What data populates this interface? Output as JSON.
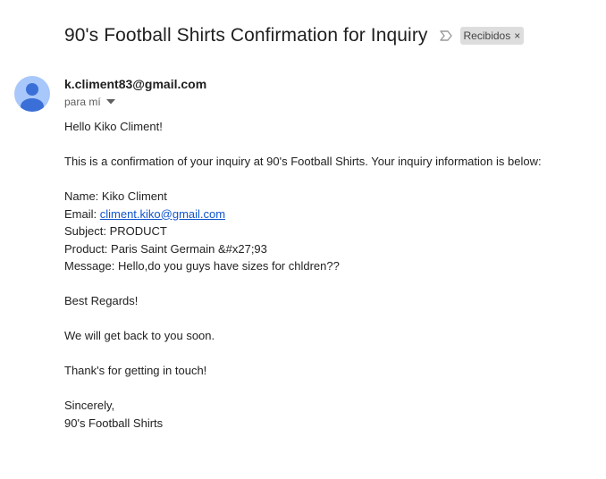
{
  "subject": {
    "title": "90's Football Shirts Confirmation for Inquiry",
    "importance_icon": "importance-marker-icon",
    "label": "Recibidos",
    "label_remove": "×"
  },
  "sender": {
    "email": "k.climent83@gmail.com",
    "recipient_text": "para mí",
    "avatar_icon": "person-icon",
    "avatar_color": "#a8c7fa",
    "avatar_figure_color": "#3b6fd8"
  },
  "body": {
    "greeting": "Hello Kiko Climent!",
    "intro": "This is a confirmation of your inquiry at 90's Football Shirts. Your inquiry information is below:",
    "name_line": "Name: Kiko Climent",
    "email_prefix": "Email: ",
    "email_link": "climent.kiko@gmail.com",
    "subject_line": "Subject: PRODUCT",
    "product_line": "Product: Paris Saint Germain &#x27;93",
    "message_line": "Message: Hello,do you guys have sizes for chldren??",
    "regards": "Best Regards!",
    "back_soon": "We will get back to you soon.",
    "thanks": "Thank's for getting in touch!",
    "sincerely": "Sincerely,",
    "signature": "90's Football Shirts"
  },
  "colors": {
    "link": "#1155cc",
    "label_bg": "#dddddd"
  }
}
